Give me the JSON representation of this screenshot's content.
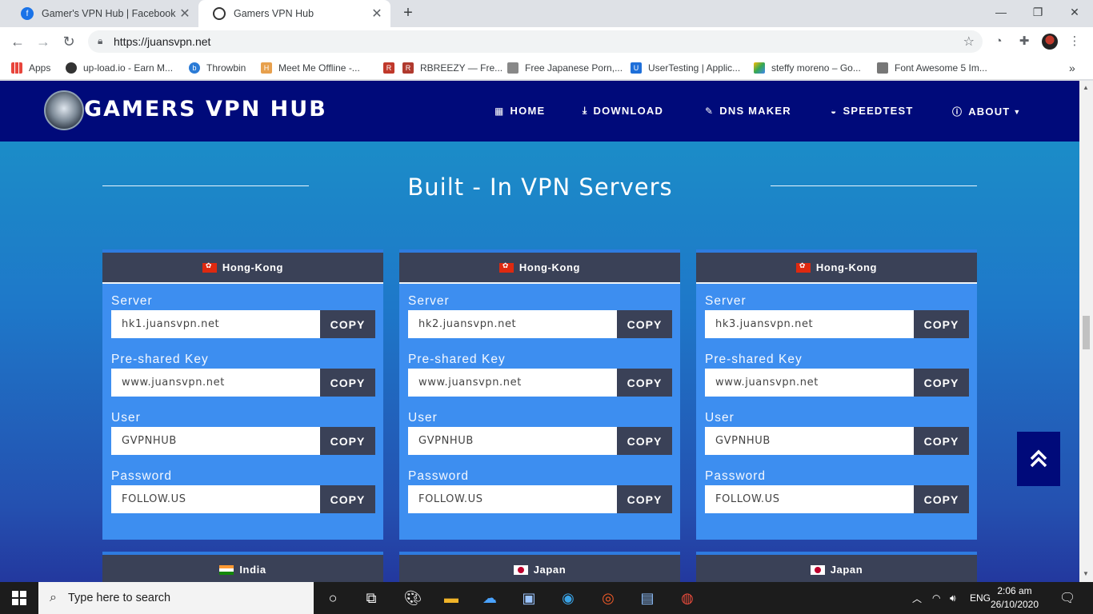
{
  "browser": {
    "tabs": [
      {
        "title": "Gamer's VPN Hub | Facebook"
      },
      {
        "title": "Gamers VPN Hub"
      }
    ],
    "url": "https://juansvpn.net",
    "bookmarks": [
      {
        "label": "Apps"
      },
      {
        "label": "up-load.io - Earn M..."
      },
      {
        "label": "Throwbin"
      },
      {
        "label": "Meet Me Offline -..."
      },
      {
        "label": ""
      },
      {
        "label": "RBREEZY — Fre..."
      },
      {
        "label": "Free Japanese Porn,..."
      },
      {
        "label": "UserTesting | Applic..."
      },
      {
        "label": "steffy moreno – Go..."
      },
      {
        "label": "Font Awesome 5 Im..."
      }
    ]
  },
  "site": {
    "brand": "GAMERS VPN HUB",
    "nav": [
      {
        "label": "HOME",
        "icon": "grid-icon"
      },
      {
        "label": "DOWNLOAD",
        "icon": "download-icon"
      },
      {
        "label": "DNS MAKER",
        "icon": "edit-icon"
      },
      {
        "label": "SPEEDTEST",
        "icon": "gauge-icon"
      },
      {
        "label": "ABOUT",
        "icon": "info-icon"
      }
    ],
    "section_title": "Built - In VPN Servers",
    "copy_label": "COPY",
    "field_labels": {
      "server": "Server",
      "psk": "Pre-shared Key",
      "user": "User",
      "password": "Password"
    },
    "cards": [
      {
        "country": "Hong-Kong",
        "server": "hk1.juansvpn.net",
        "psk": "www.juansvpn.net",
        "user": "GVPNHUB",
        "password": "FOLLOW.US"
      },
      {
        "country": "Hong-Kong",
        "server": "hk2.juansvpn.net",
        "psk": "www.juansvpn.net",
        "user": "GVPNHUB",
        "password": "FOLLOW.US"
      },
      {
        "country": "Hong-Kong",
        "server": "hk3.juansvpn.net",
        "psk": "www.juansvpn.net",
        "user": "GVPNHUB",
        "password": "FOLLOW.US"
      }
    ],
    "next_cards": [
      {
        "country": "India"
      },
      {
        "country": "Japan"
      },
      {
        "country": "Japan"
      }
    ]
  },
  "taskbar": {
    "search_placeholder": "Type here to search",
    "language": "ENG",
    "time": "2:06 am",
    "date": "26/10/2020"
  }
}
